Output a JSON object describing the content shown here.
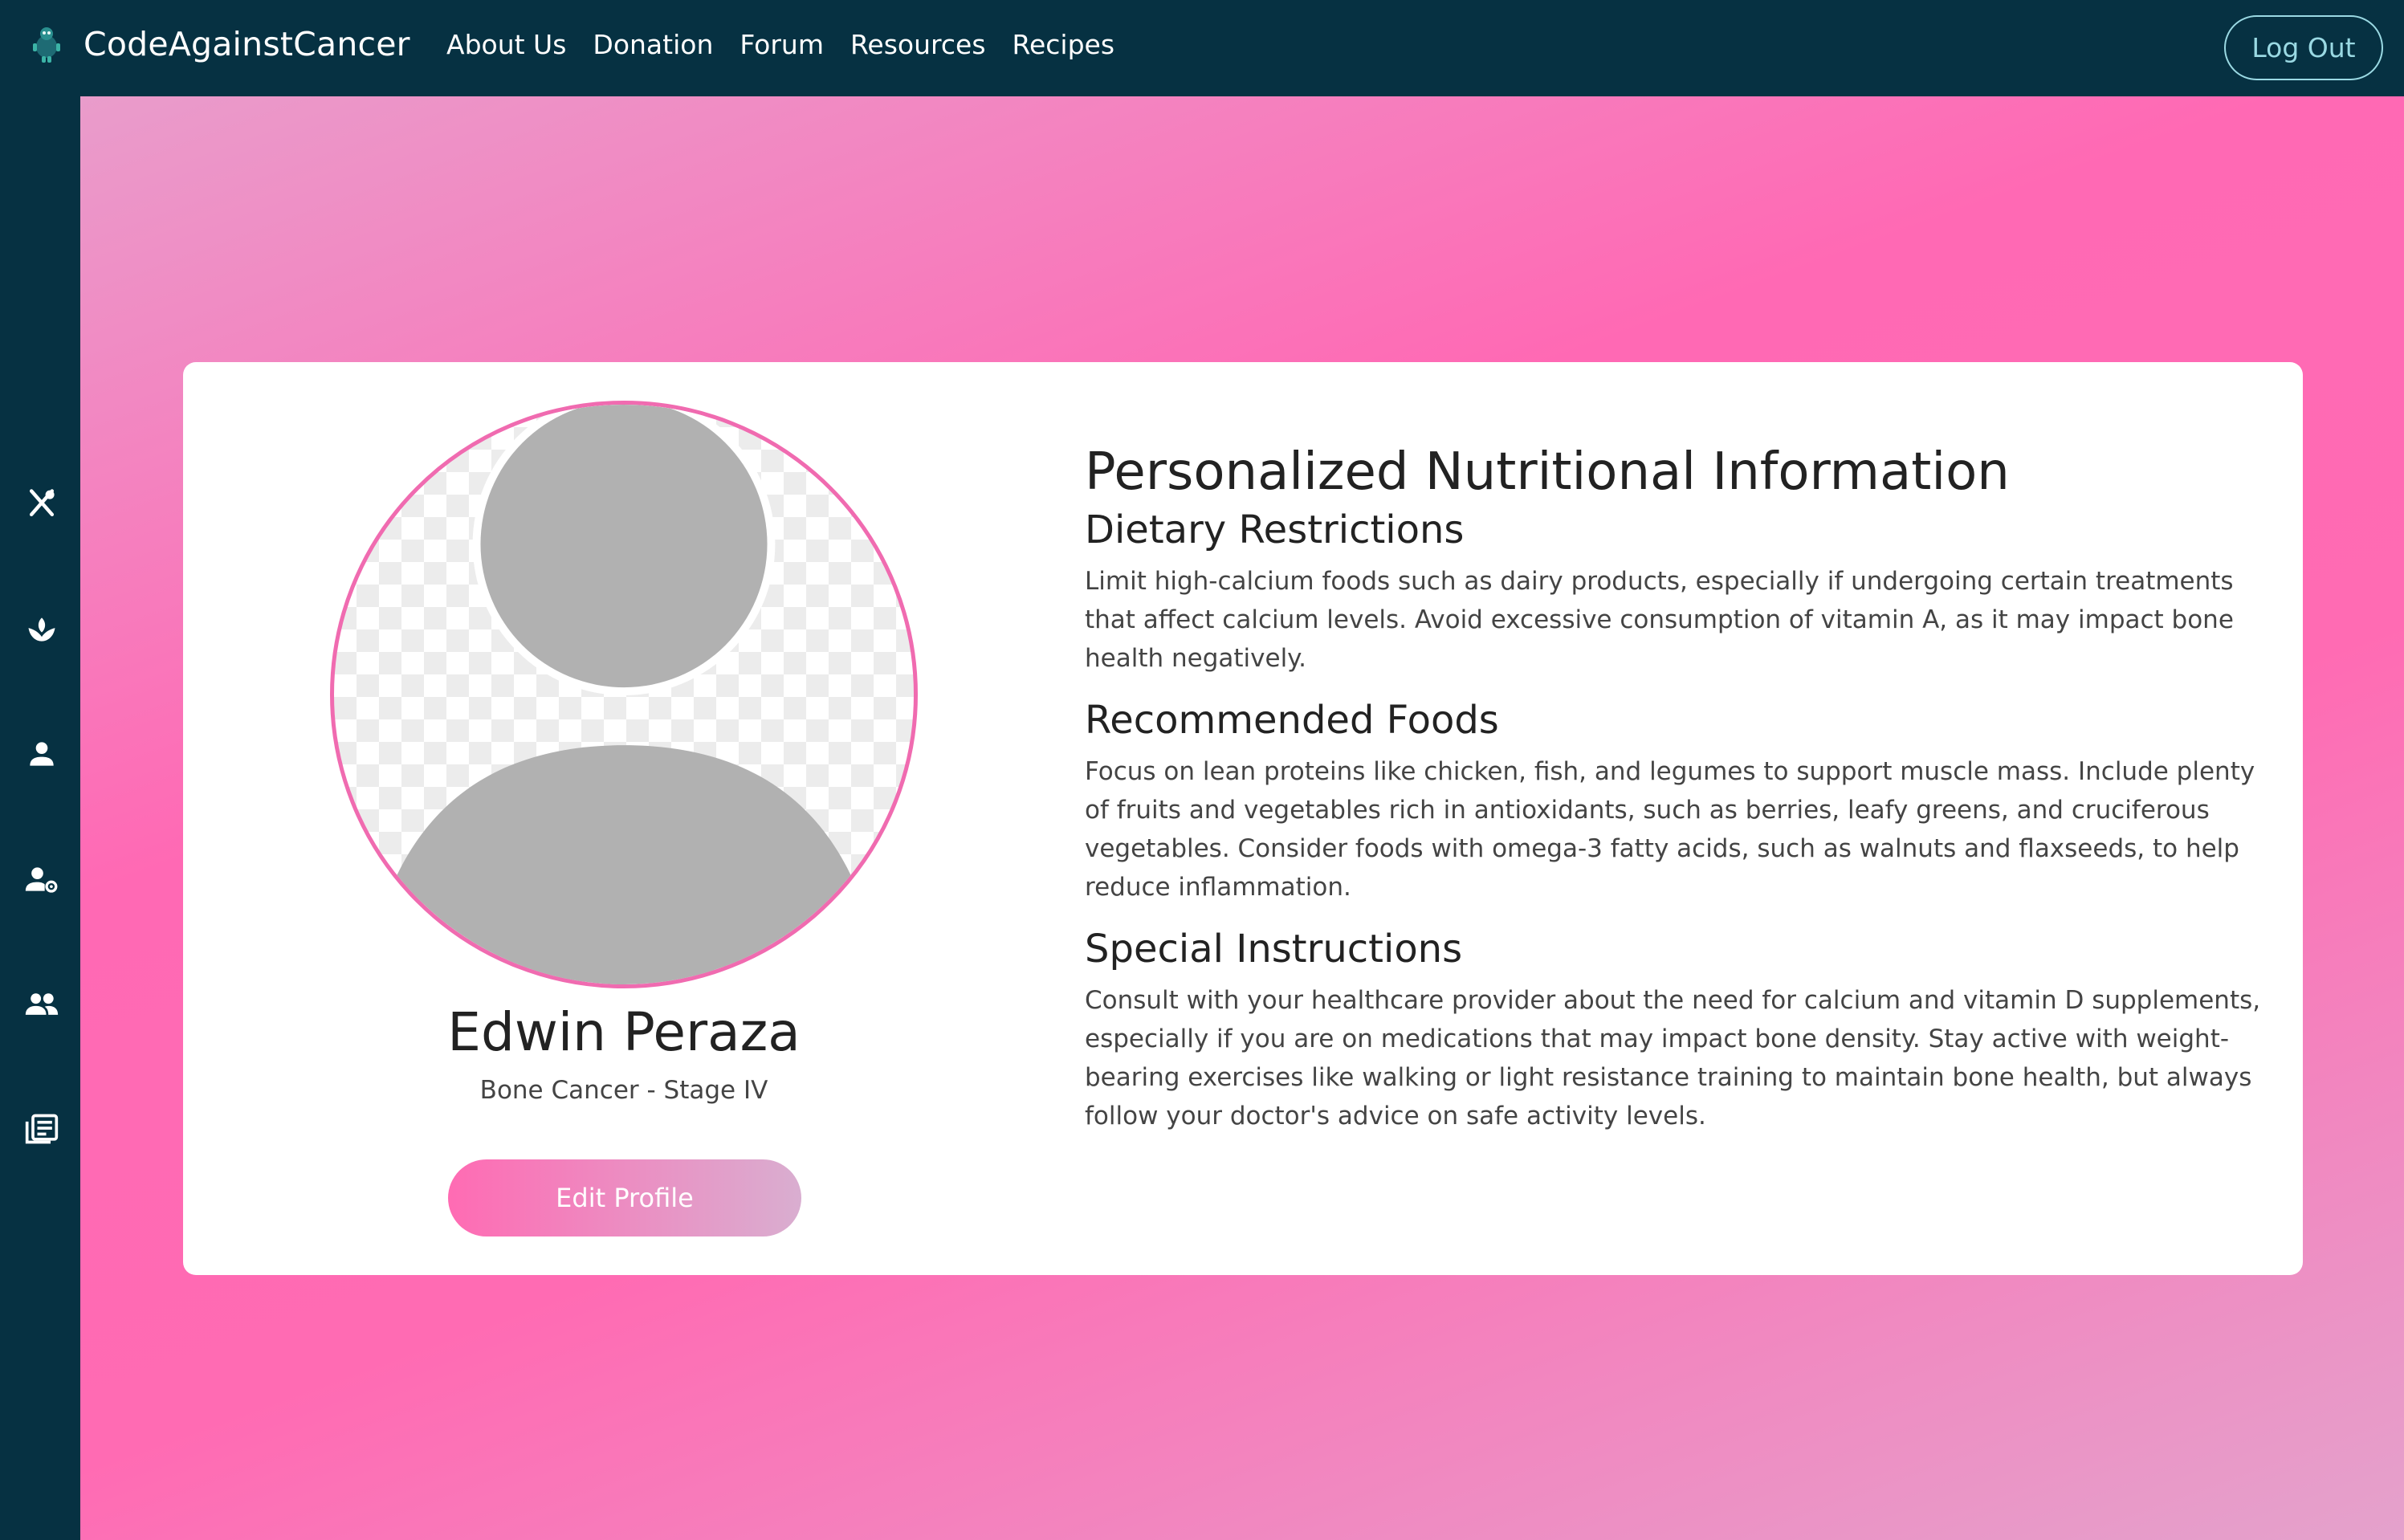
{
  "brand": {
    "name": "CodeAgainstCancer"
  },
  "nav": {
    "items": [
      "About Us",
      "Donation",
      "Forum",
      "Resources",
      "Recipes"
    ],
    "logout_label": "Log Out"
  },
  "sidebar": {
    "icons": [
      "utensils-icon",
      "lotus-icon",
      "user-icon",
      "user-settings-icon",
      "group-icon",
      "newspaper-icon"
    ]
  },
  "profile": {
    "name": "Edwin Peraza",
    "diagnosis": "Bone Cancer - Stage IV",
    "edit_label": "Edit Profile"
  },
  "nutrition": {
    "title": "Personalized Nutritional Information",
    "sections": [
      {
        "heading": "Dietary Restrictions",
        "text": "Limit high-calcium foods such as dairy products, especially if undergoing certain treatments that affect calcium levels. Avoid excessive consumption of vitamin A, as it may impact bone health negatively."
      },
      {
        "heading": "Recommended Foods",
        "text": "Focus on lean proteins like chicken, fish, and legumes to support muscle mass. Include plenty of fruits and vegetables rich in antioxidants, such as berries, leafy greens, and cruciferous vegetables. Consider foods with omega-3 fatty acids, such as walnuts and flaxseeds, to help reduce inflammation."
      },
      {
        "heading": "Special Instructions",
        "text": "Consult with your healthcare provider about the need for calcium and vitamin D supplements, especially if you are on medications that may impact bone density. Stay active with weight-bearing exercises like walking or light resistance training to maintain bone health, but always follow your doctor's advice on safe activity levels."
      }
    ]
  },
  "colors": {
    "navbar": "#063142",
    "accent_pink": "#ff69b4",
    "logout_outline": "#9ad9e3",
    "card": "#ffffff"
  }
}
